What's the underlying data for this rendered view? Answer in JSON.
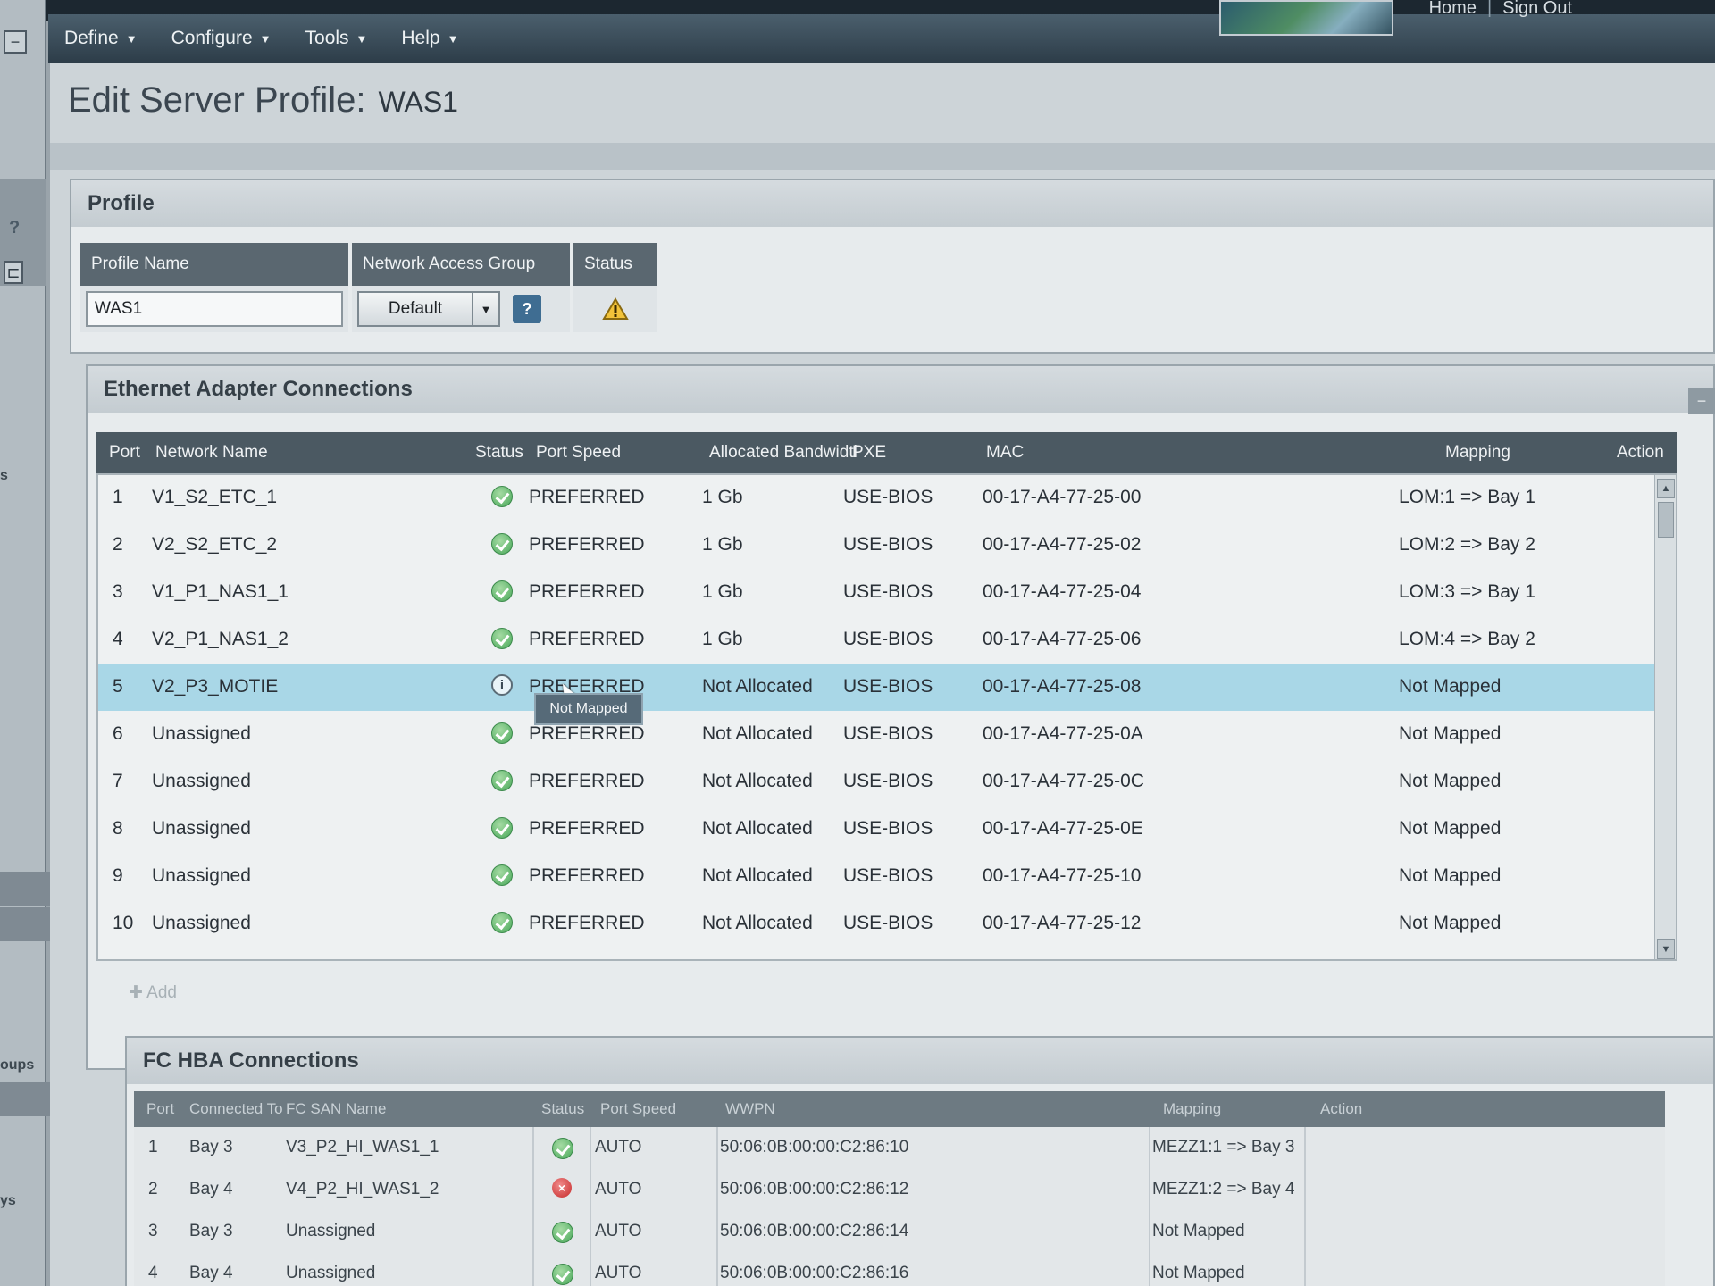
{
  "menu": {
    "items": [
      {
        "label": "Define"
      },
      {
        "label": "Configure"
      },
      {
        "label": "Tools"
      },
      {
        "label": "Help"
      }
    ],
    "home": "Home",
    "sign_out": "Sign Out",
    "separator": "|"
  },
  "rail": {
    "help": "?",
    "frag1": "s",
    "frag2": "oups",
    "frag3": "ys"
  },
  "page": {
    "title": "Edit Server Profile:",
    "subject": "WAS1"
  },
  "profile": {
    "section_title": "Profile",
    "headers": {
      "name": "Profile Name",
      "nag": "Network Access Group",
      "status": "Status"
    },
    "name_value": "WAS1",
    "nag_value": "Default",
    "help_label": "?",
    "status_icon": "warning-icon"
  },
  "ethernet": {
    "section_title": "Ethernet Adapter Connections",
    "columns": {
      "port": "Port",
      "network": "Network Name",
      "status": "Status",
      "speed": "Port Speed",
      "bandwidth": "Allocated Bandwidtl",
      "pxe": "PXE",
      "mac": "MAC",
      "mapping": "Mapping",
      "action": "Action"
    },
    "rows": [
      {
        "port": "1",
        "network": "V1_S2_ETC_1",
        "status": "ok",
        "speed": "PREFERRED",
        "bandwidth": "1 Gb",
        "pxe": "USE-BIOS",
        "mac": "00-17-A4-77-25-00",
        "mapping": "LOM:1 => Bay 1"
      },
      {
        "port": "2",
        "network": "V2_S2_ETC_2",
        "status": "ok",
        "speed": "PREFERRED",
        "bandwidth": "1 Gb",
        "pxe": "USE-BIOS",
        "mac": "00-17-A4-77-25-02",
        "mapping": "LOM:2 => Bay 2"
      },
      {
        "port": "3",
        "network": "V1_P1_NAS1_1",
        "status": "ok",
        "speed": "PREFERRED",
        "bandwidth": "1 Gb",
        "pxe": "USE-BIOS",
        "mac": "00-17-A4-77-25-04",
        "mapping": "LOM:3 => Bay 1"
      },
      {
        "port": "4",
        "network": "V2_P1_NAS1_2",
        "status": "ok",
        "speed": "PREFERRED",
        "bandwidth": "1 Gb",
        "pxe": "USE-BIOS",
        "mac": "00-17-A4-77-25-06",
        "mapping": "LOM:4 => Bay 2"
      },
      {
        "port": "5",
        "network": "V2_P3_MOTIE",
        "status": "info",
        "speed": "PREFERRED",
        "bandwidth": "Not Allocated",
        "pxe": "USE-BIOS",
        "mac": "00-17-A4-77-25-08",
        "mapping": "Not Mapped"
      },
      {
        "port": "6",
        "network": "Unassigned",
        "status": "ok",
        "speed": "PREFERRED",
        "bandwidth": "Not Allocated",
        "pxe": "USE-BIOS",
        "mac": "00-17-A4-77-25-0A",
        "mapping": "Not Mapped"
      },
      {
        "port": "7",
        "network": "Unassigned",
        "status": "ok",
        "speed": "PREFERRED",
        "bandwidth": "Not Allocated",
        "pxe": "USE-BIOS",
        "mac": "00-17-A4-77-25-0C",
        "mapping": "Not Mapped"
      },
      {
        "port": "8",
        "network": "Unassigned",
        "status": "ok",
        "speed": "PREFERRED",
        "bandwidth": "Not Allocated",
        "pxe": "USE-BIOS",
        "mac": "00-17-A4-77-25-0E",
        "mapping": "Not Mapped"
      },
      {
        "port": "9",
        "network": "Unassigned",
        "status": "ok",
        "speed": "PREFERRED",
        "bandwidth": "Not Allocated",
        "pxe": "USE-BIOS",
        "mac": "00-17-A4-77-25-10",
        "mapping": "Not Mapped"
      },
      {
        "port": "10",
        "network": "Unassigned",
        "status": "ok",
        "speed": "PREFERRED",
        "bandwidth": "Not Allocated",
        "pxe": "USE-BIOS",
        "mac": "00-17-A4-77-25-12",
        "mapping": "Not Mapped"
      }
    ],
    "tooltip": "Not Mapped",
    "add_label": "Add"
  },
  "fc": {
    "section_title": "FC HBA Connections",
    "columns": {
      "port": "Port",
      "connected": "Connected To",
      "san": "FC SAN Name",
      "status": "Status",
      "speed": "Port Speed",
      "wwpn": "WWPN",
      "mapping": "Mapping",
      "action": "Action"
    },
    "rows": [
      {
        "port": "1",
        "connected": "Bay 3",
        "san": "V3_P2_HI_WAS1_1",
        "status": "ok",
        "speed": "AUTO",
        "wwpn": "50:06:0B:00:00:C2:86:10",
        "mapping": "MEZZ1:1 => Bay 3"
      },
      {
        "port": "2",
        "connected": "Bay 4",
        "san": "V4_P2_HI_WAS1_2",
        "status": "error",
        "speed": "AUTO",
        "wwpn": "50:06:0B:00:00:C2:86:12",
        "mapping": "MEZZ1:2 => Bay 4"
      },
      {
        "port": "3",
        "connected": "Bay 3",
        "san": "Unassigned",
        "status": "ok",
        "speed": "AUTO",
        "wwpn": "50:06:0B:00:00:C2:86:14",
        "mapping": "Not Mapped"
      },
      {
        "port": "4",
        "connected": "Bay 4",
        "san": "Unassigned",
        "status": "ok",
        "speed": "AUTO",
        "wwpn": "50:06:0B:00:00:C2:86:16",
        "mapping": "Not Mapped"
      }
    ]
  },
  "colors": {
    "menubar": "#2d3d49",
    "header": "#4b5962",
    "selected_row": "#a9d7e7",
    "ok": "#49a85a",
    "error": "#c62a2a"
  }
}
